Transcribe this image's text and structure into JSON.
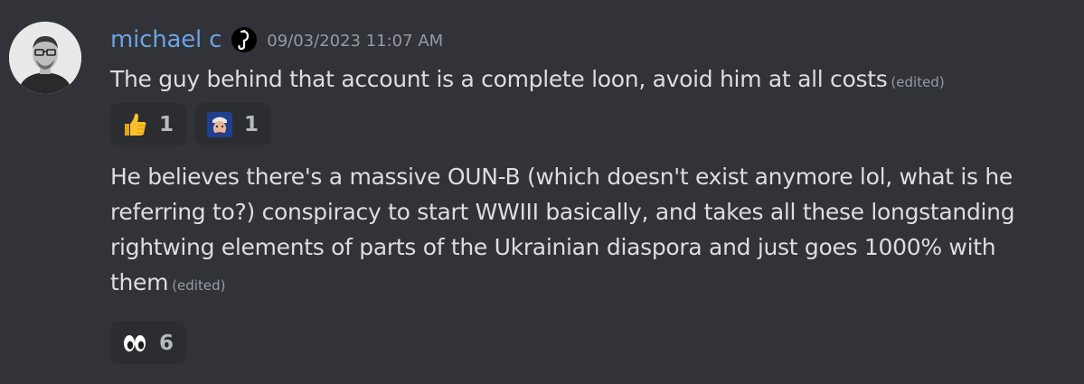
{
  "message": {
    "author": {
      "username": "michael c",
      "avatar_icon": "user-avatar",
      "badge_icon": "question-hook-icon"
    },
    "timestamp": "09/03/2023 11:07 AM",
    "colors": {
      "background": "#313338",
      "username": "#6ba3e0",
      "text": "#dbdee1",
      "muted": "#949ba4",
      "reaction_bg": "#2b2d31"
    },
    "posts": [
      {
        "text": "The guy behind that account is a complete loon, avoid him at all costs",
        "edited_label": "(edited)",
        "reactions": [
          {
            "emoji_icon": "thumbs-up-icon",
            "count": "1"
          },
          {
            "emoji_icon": "custom-face-emoji-icon",
            "count": "1"
          }
        ]
      },
      {
        "text": "He believes there's a massive OUN-B (which doesn't exist anymore lol, what is he referring to?) conspiracy to start WWIII basically, and takes all these longstanding rightwing elements of parts of the Ukrainian diaspora and just goes 1000% with them",
        "edited_label": "(edited)",
        "reactions": [
          {
            "emoji_icon": "eyes-icon",
            "count": "6"
          }
        ]
      }
    ]
  }
}
